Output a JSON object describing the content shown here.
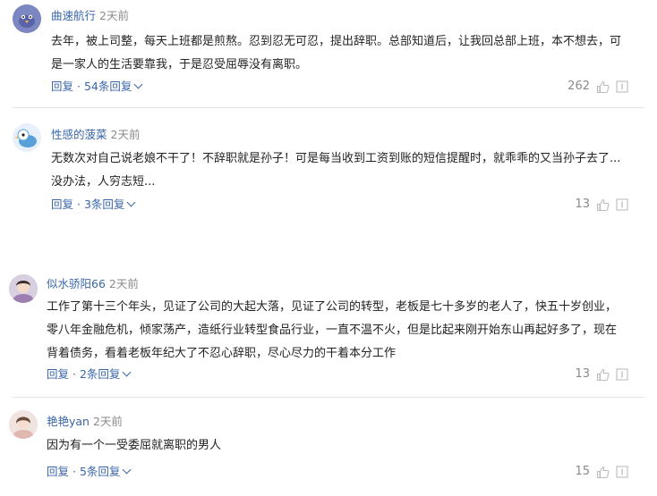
{
  "comments": [
    {
      "username": "曲速航行",
      "time": "2天前",
      "text": "去年，被上司整，每天上班都是煎熬。忍到忍无可忍，提出辞职。总部知道后，让我回总部上班，本不想去，可是一家人的生活要靠我，于是忍受屈辱没有离职。",
      "reply_label": "回复",
      "sep": "·",
      "replies_label": "54条回复",
      "likes": "262",
      "avatar": "avatar-blue-bird"
    },
    {
      "username": "性感的菠菜",
      "time": "2天前",
      "text": "无数次对自己说老娘不干了！不辞职就是孙子！可是每当收到工资到账的短信提醒时，就乖乖的又当孙子去了...没办法，人穷志短...",
      "reply_label": "回复",
      "sep": "·",
      "replies_label": "3条回复",
      "likes": "13",
      "avatar": "avatar-cartoon-bird"
    },
    {
      "username": "似水骄阳66",
      "time": "2天前",
      "text": "工作了第十三个年头，见证了公司的大起大落，见证了公司的转型，老板是七十多岁的老人了，快五十岁创业，零八年金融危机，倾家荡产，造纸行业转型食品行业，一直不温不火，但是比起来刚开始东山再起好多了，现在背着债务，看着老板年纪大了不忍心辞职，尽心尽力的干着本分工作",
      "reply_label": "回复",
      "sep": "·",
      "replies_label": "2条回复",
      "likes": "13",
      "avatar": "avatar-girl-photo"
    },
    {
      "username": "艳艳yan",
      "time": "2天前",
      "text": "因为有一个一受委屈就离职的男人",
      "reply_label": "回复",
      "sep": "·",
      "replies_label": "5条回复",
      "likes": "15",
      "avatar": "avatar-woman-photo"
    }
  ],
  "colors": {
    "username": "#3a66a8",
    "time": "#8a8a8a",
    "text": "#222222",
    "action": "#3a66a8",
    "icon": "#bbbbbb"
  }
}
